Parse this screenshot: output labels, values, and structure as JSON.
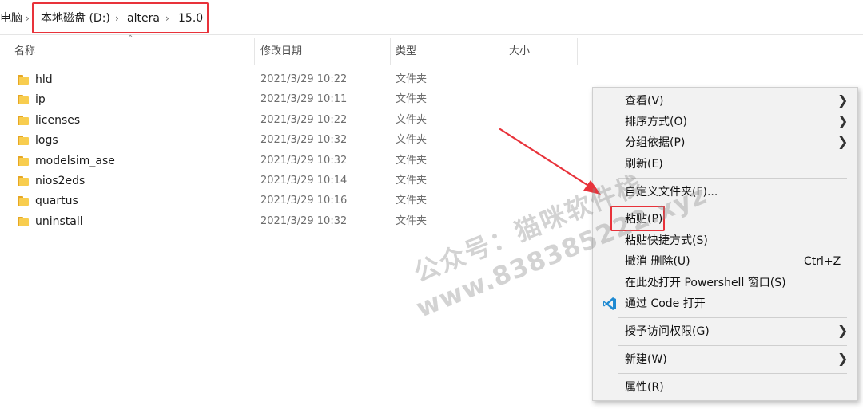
{
  "breadcrumb": {
    "parent": "电脑",
    "drive": "本地磁盘 (D:)",
    "folder": "altera",
    "current": "15.0"
  },
  "columns": {
    "name": "名称",
    "date": "修改日期",
    "type": "类型",
    "size": "大小"
  },
  "files": [
    {
      "name": "hld",
      "date": "2021/3/29 10:22",
      "type": "文件夹"
    },
    {
      "name": "ip",
      "date": "2021/3/29 10:11",
      "type": "文件夹"
    },
    {
      "name": "licenses",
      "date": "2021/3/29 10:22",
      "type": "文件夹"
    },
    {
      "name": "logs",
      "date": "2021/3/29 10:32",
      "type": "文件夹"
    },
    {
      "name": "modelsim_ase",
      "date": "2021/3/29 10:32",
      "type": "文件夹"
    },
    {
      "name": "nios2eds",
      "date": "2021/3/29 10:14",
      "type": "文件夹"
    },
    {
      "name": "quartus",
      "date": "2021/3/29 10:16",
      "type": "文件夹"
    },
    {
      "name": "uninstall",
      "date": "2021/3/29 10:32",
      "type": "文件夹"
    }
  ],
  "context_menu": {
    "view": "查看(V)",
    "sort": "排序方式(O)",
    "group": "分组依据(P)",
    "refresh": "刷新(E)",
    "customize": "自定义文件夹(F)...",
    "paste": "粘贴(P)",
    "paste_shortcut": "粘贴快捷方式(S)",
    "undo_delete": "撤消 删除(U)",
    "undo_shortcut": "Ctrl+Z",
    "powershell": "在此处打开 Powershell 窗口(S)",
    "vscode": "通过 Code 打开",
    "grant_access": "授予访问权限(G)",
    "new": "新建(W)",
    "properties": "属性(R)"
  },
  "watermark": {
    "line1": "公众号：猫咪软件栈",
    "line2": "www.838385222.xyz"
  },
  "colors": {
    "highlight": "#e8323a",
    "folder": "#f8cd4f",
    "menu_bg": "#f2f2f2",
    "vscode_blue": "#1f8ad2"
  },
  "icons": {
    "folder": "folder-icon",
    "chevron": "chevron-right-icon",
    "vscode": "vscode-icon",
    "sort": "sort-up-icon"
  }
}
